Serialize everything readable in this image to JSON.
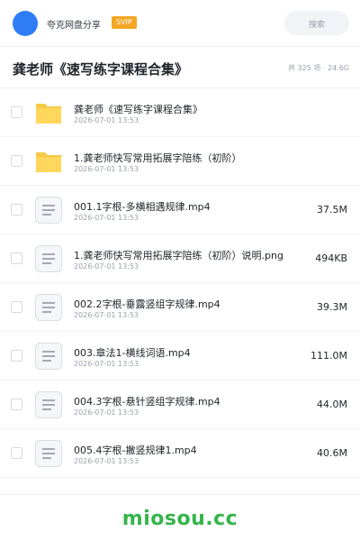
{
  "header": {
    "app_name": "夸克网盘分享",
    "badge": "SVIP",
    "search_placeholder": "搜索",
    "accent_color": "#2f7cf6",
    "badge_color": "#f5a623"
  },
  "folder": {
    "title": "龚老师《速写练字课程合集》",
    "meta": "共 325 项 · 24.6G"
  },
  "files": [
    {
      "name": "龚老师《速写练字课程合集》",
      "date": "2026-07-01 13:53",
      "size": "",
      "type": "folder",
      "icon": "folder-icon"
    },
    {
      "name": "1.龚老师快写常用拓展字陪练（初阶）",
      "date": "2026-07-01 13:53",
      "size": "",
      "type": "folder",
      "icon": "folder-icon"
    },
    {
      "name": "001.1字根-多横相遇规律.mp4",
      "date": "2026-07-01 13:53",
      "size": "37.5M",
      "type": "file",
      "icon": "document-icon"
    },
    {
      "name": "1.龚老师快写常用拓展字陪练（初阶）说明.png",
      "date": "2026-07-01 13:53",
      "size": "494KB",
      "type": "file",
      "icon": "document-icon"
    },
    {
      "name": "002.2字根-垂露竖组字规律.mp4",
      "date": "2026-07-01 13:53",
      "size": "39.3M",
      "type": "file",
      "icon": "document-icon"
    },
    {
      "name": "003.章法1-横线词语.mp4",
      "date": "2026-07-01 13:53",
      "size": "111.0M",
      "type": "file",
      "icon": "document-icon"
    },
    {
      "name": "004.3字根-悬针竖组字规律.mp4",
      "date": "2026-07-01 13:53",
      "size": "44.0M",
      "type": "file",
      "icon": "document-icon"
    },
    {
      "name": "005.4字根-撇竖规律1.mp4",
      "date": "2026-07-01 13:53",
      "size": "40.6M",
      "type": "file",
      "icon": "document-icon"
    }
  ],
  "footer": {
    "watermark": "miosou.cc",
    "watermark_color": "#35b44a"
  }
}
